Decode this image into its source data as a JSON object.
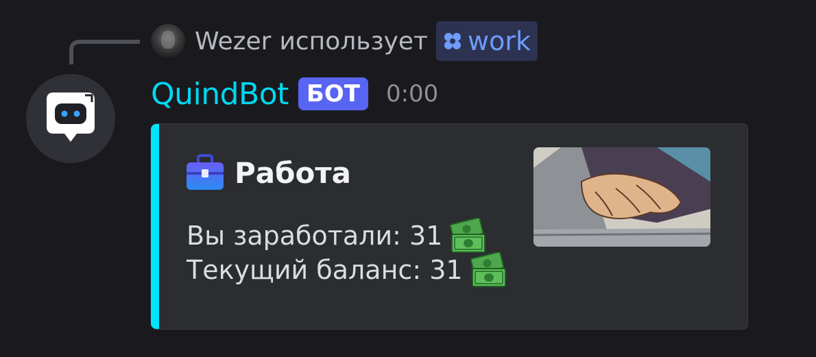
{
  "reply": {
    "username": "Wezer",
    "action": "использует",
    "command": "work",
    "command_icon": "slash-command-icon"
  },
  "message": {
    "author": "QuindBot",
    "badge": "БОТ",
    "timestamp": "0:00",
    "author_color": "#00d8f0"
  },
  "embed": {
    "accent_color": "#00e5ff",
    "title_icon": "briefcase-icon",
    "title": "Работа",
    "lines": [
      {
        "text": "Вы заработали: 31",
        "icon": "money-icon"
      },
      {
        "text": "Текущий баланс: 31",
        "icon": "money-icon"
      }
    ],
    "thumbnail": "laptop-typing-gif"
  }
}
